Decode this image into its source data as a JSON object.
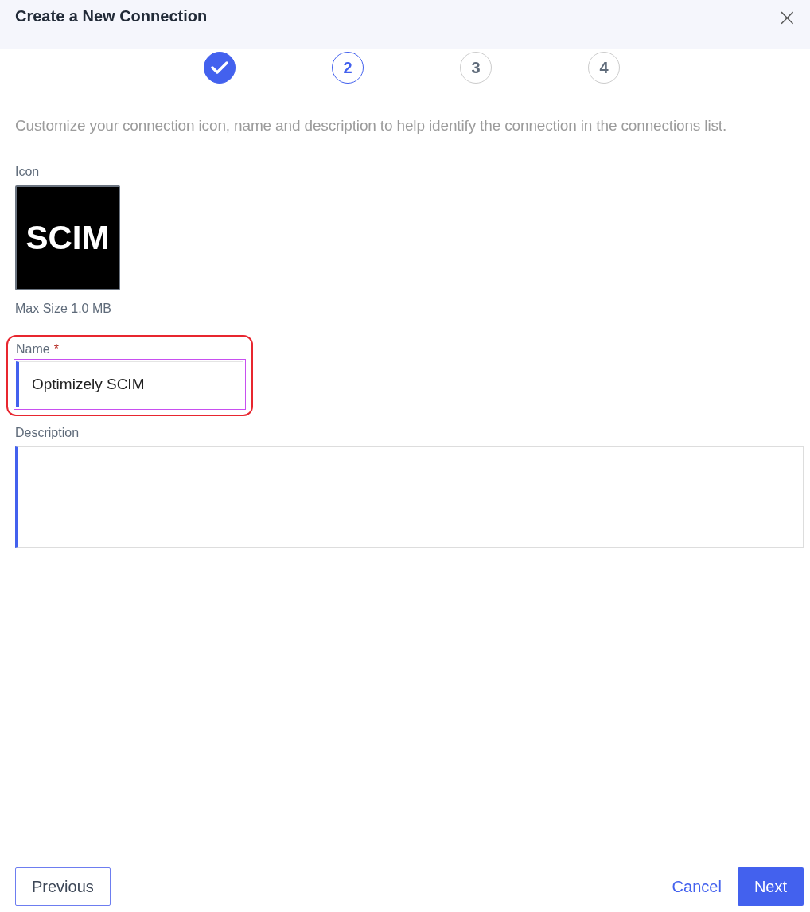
{
  "dialog": {
    "title": "Create a New Connection",
    "close": "×"
  },
  "steps": [
    {
      "done": true,
      "selected": false
    },
    {
      "label": "2",
      "done": false,
      "selected": true
    },
    {
      "label": "3",
      "done": false,
      "selected": false
    },
    {
      "label": "4",
      "done": false,
      "selected": false
    }
  ],
  "intro": "Customize your connection icon, name and description to help identify the connection in the connections list.",
  "icon_field": {
    "label": "Icon",
    "logo_text": "SCIM",
    "hint": "Max Size 1.0 MB"
  },
  "name_field": {
    "label": "Name",
    "required_mark": "*",
    "value": "Optimizely SCIM",
    "focused": true,
    "highlighted": true
  },
  "description_field": {
    "label": "Description"
  },
  "buttons": [
    {
      "label": "Previous",
      "kind": "outline"
    },
    {
      "label": "Cancel",
      "kind": "link"
    },
    {
      "label": "Next",
      "kind": "primary"
    }
  ]
}
